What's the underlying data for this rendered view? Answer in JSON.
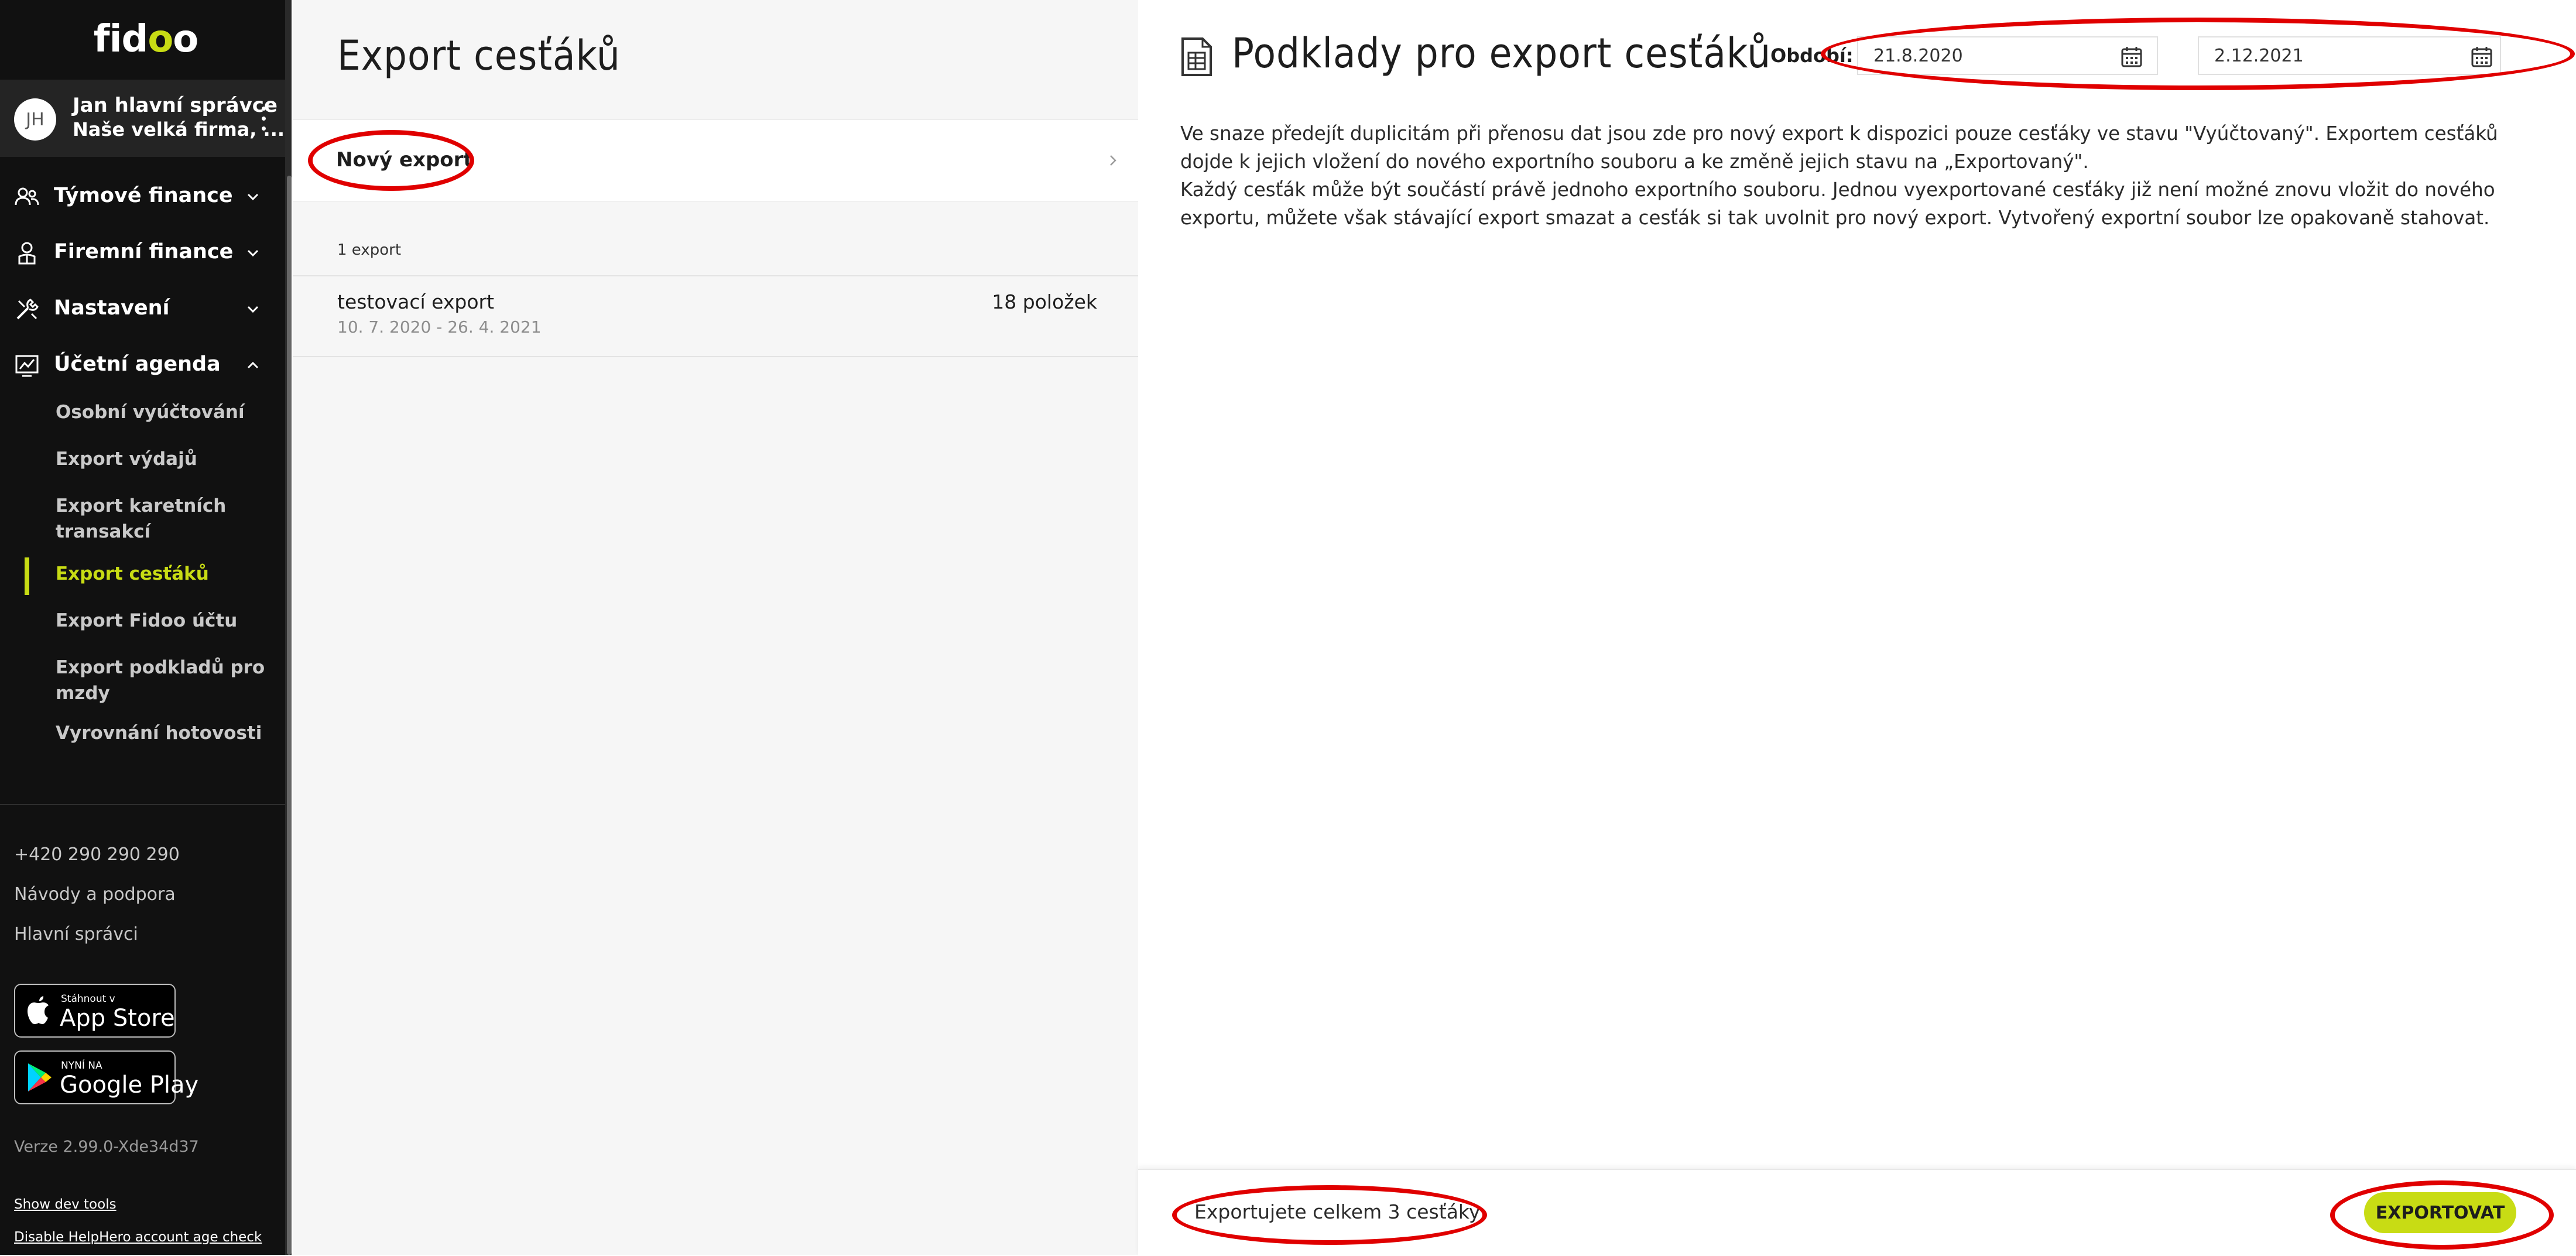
{
  "sidebar": {
    "logo": {
      "part1": "fid",
      "part2": "o",
      "part3": "o"
    },
    "user": {
      "initials": "JH",
      "name": "Jan hlavní správce",
      "company": "Naše velká firma, ..."
    },
    "nav": [
      {
        "label": "Týmové finance",
        "icon": "team-icon"
      },
      {
        "label": "Firemní finance",
        "icon": "company-icon"
      },
      {
        "label": "Nastavení",
        "icon": "settings-icon"
      },
      {
        "label": "Účetní agenda",
        "icon": "accounting-icon"
      }
    ],
    "sub_items": [
      {
        "label": "Osobní vyúčtování"
      },
      {
        "label": "Export výdajů"
      },
      {
        "label": "Export karetních transakcí"
      },
      {
        "label": "Export cesťáků",
        "active": true
      },
      {
        "label": "Export Fidoo účtu"
      },
      {
        "label": "Export podkladů pro mzdy"
      },
      {
        "label": "Vyrovnání hotovosti"
      }
    ],
    "phone": "+420 290 290 290",
    "help": "Návody a podpora",
    "admins": "Hlavní správci",
    "app_store": {
      "small": "Stáhnout v",
      "big": "App Store"
    },
    "google_play": {
      "small": "NYNÍ NA",
      "big": "Google Play"
    },
    "version": "Verze 2.99.0-Xde34d37",
    "dev_tools": "Show dev tools",
    "helphero": "Disable HelpHero account age check"
  },
  "middle": {
    "title": "Export cesťáků",
    "new_export": "Nový export",
    "count": "1 export",
    "exports": [
      {
        "name": "testovací export",
        "dates": "10. 7. 2020 - 26. 4. 2021",
        "items": "18 položek"
      }
    ]
  },
  "right": {
    "title": "Podklady pro export cesťáků",
    "period_label": "Období:",
    "date_from": "21.8.2020",
    "date_to": "2.12.2021",
    "paragraph1": "Ve snaze předejít duplicitám při přenosu dat jsou zde pro nový export k dispozici pouze cesťáky ve stavu \"Vyúčtovaný\". Exportem cesťáků dojde k jejich vložení do nového exportního souboru a ke změně jejich stavu na „Exportovaný\".",
    "paragraph2": "Každý cesťák může být součástí právě jednoho exportního souboru. Jednou vyexportované cesťáky již není možné znovu vložit do nového exportu, můžete však stávající export smazat a cesťák si tak uvolnit pro nový export. Vytvořený exportní soubor lze opakovaně stahovat.",
    "footer_text": "Exportujete celkem 3 cesťáky",
    "export_button": "EXPORTOVAT"
  },
  "colors": {
    "accent": "#c8dc14",
    "sidebar_bg": "#111111",
    "annotation": "#e00000"
  }
}
